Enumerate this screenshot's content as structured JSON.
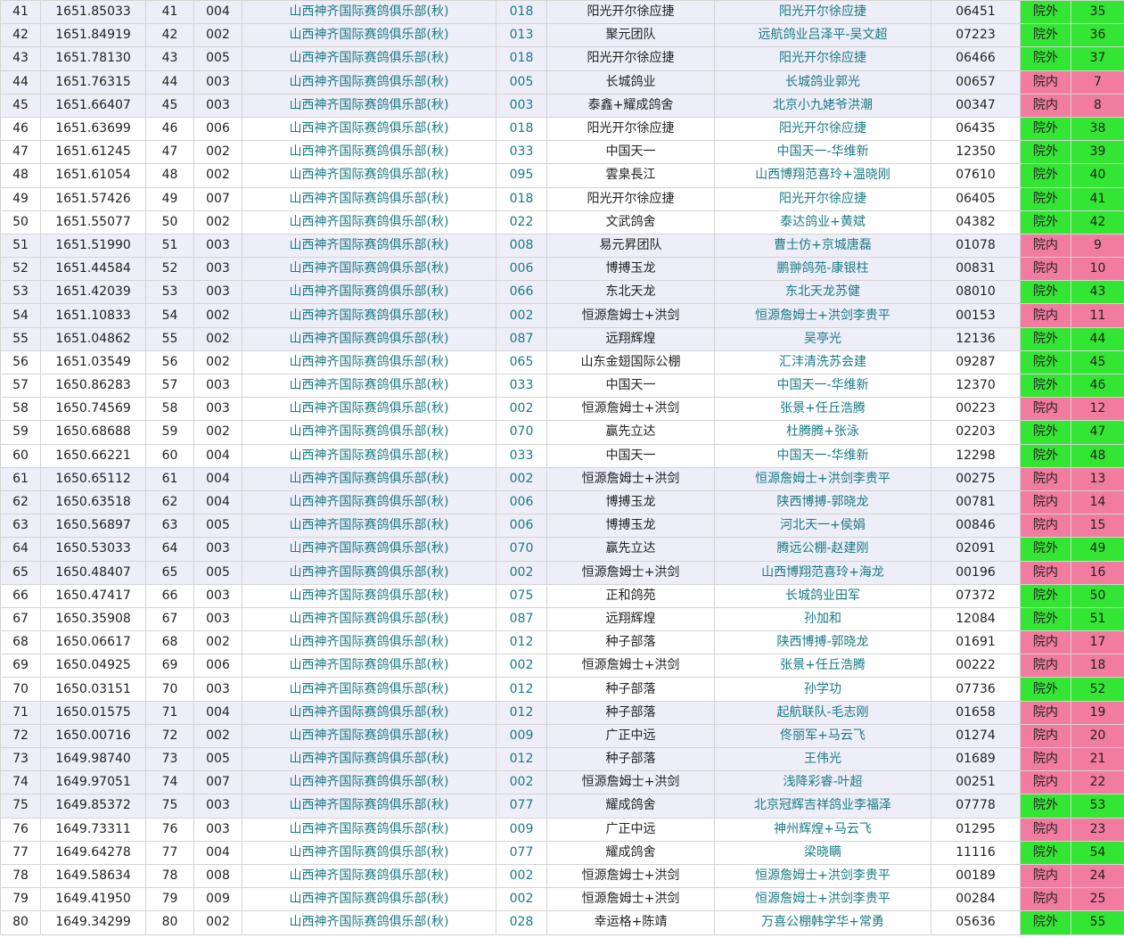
{
  "columns": [
    "rank",
    "speed",
    "order",
    "count",
    "club",
    "club_no",
    "team",
    "owner",
    "ring",
    "status",
    "group_rank"
  ],
  "colors": {
    "in": "#f27ba0",
    "out": "#33e633",
    "teal": "#1a7a84",
    "band": "#eeeef9"
  },
  "rows": [
    [
      "41",
      "1651.85033",
      "41",
      "004",
      "山西神齐国际赛鸽俱乐部(秋)",
      "018",
      "阳光开尔徐应捷",
      "阳光开尔徐应捷",
      "06451",
      "院外",
      "35"
    ],
    [
      "42",
      "1651.84919",
      "42",
      "002",
      "山西神齐国际赛鸽俱乐部(秋)",
      "013",
      "聚元团队",
      "远航鸽业吕泽平-吴文超",
      "07223",
      "院外",
      "36"
    ],
    [
      "43",
      "1651.78130",
      "43",
      "005",
      "山西神齐国际赛鸽俱乐部(秋)",
      "018",
      "阳光开尔徐应捷",
      "阳光开尔徐应捷",
      "06466",
      "院外",
      "37"
    ],
    [
      "44",
      "1651.76315",
      "44",
      "003",
      "山西神齐国际赛鸽俱乐部(秋)",
      "005",
      "长城鸽业",
      "长城鸽业郭光",
      "00657",
      "院内",
      "7"
    ],
    [
      "45",
      "1651.66407",
      "45",
      "003",
      "山西神齐国际赛鸽俱乐部(秋)",
      "003",
      "泰鑫+耀成鸽舍",
      "北京小九姥爷洪潮",
      "00347",
      "院内",
      "8"
    ],
    [
      "46",
      "1651.63699",
      "46",
      "006",
      "山西神齐国际赛鸽俱乐部(秋)",
      "018",
      "阳光开尔徐应捷",
      "阳光开尔徐应捷",
      "06435",
      "院外",
      "38"
    ],
    [
      "47",
      "1651.61245",
      "47",
      "002",
      "山西神齐国际赛鸽俱乐部(秋)",
      "033",
      "中国天一",
      "中国天一-华维新",
      "12350",
      "院外",
      "39"
    ],
    [
      "48",
      "1651.61054",
      "48",
      "002",
      "山西神齐国际赛鸽俱乐部(秋)",
      "095",
      "雲臬長江",
      "山西博翔范喜玲+温晓刚",
      "07610",
      "院外",
      "40"
    ],
    [
      "49",
      "1651.57426",
      "49",
      "007",
      "山西神齐国际赛鸽俱乐部(秋)",
      "018",
      "阳光开尔徐应捷",
      "阳光开尔徐应捷",
      "06405",
      "院外",
      "41"
    ],
    [
      "50",
      "1651.55077",
      "50",
      "002",
      "山西神齐国际赛鸽俱乐部(秋)",
      "022",
      "文武鸽舍",
      "泰达鸽业+黄斌",
      "04382",
      "院外",
      "42"
    ],
    [
      "51",
      "1651.51990",
      "51",
      "003",
      "山西神齐国际赛鸽俱乐部(秋)",
      "008",
      "易元昇团队",
      "曹士仿+京城唐磊",
      "01078",
      "院内",
      "9"
    ],
    [
      "52",
      "1651.44584",
      "52",
      "003",
      "山西神齐国际赛鸽俱乐部(秋)",
      "006",
      "博搏玉龙",
      "鹏翀鸽苑-康银柱",
      "00831",
      "院内",
      "10"
    ],
    [
      "53",
      "1651.42039",
      "53",
      "003",
      "山西神齐国际赛鸽俱乐部(秋)",
      "066",
      "东北天龙",
      "东北天龙苏健",
      "08010",
      "院外",
      "43"
    ],
    [
      "54",
      "1651.10833",
      "54",
      "002",
      "山西神齐国际赛鸽俱乐部(秋)",
      "002",
      "恒源詹姆士+洪剑",
      "恒源詹姆士+洪剑李贵平",
      "00153",
      "院内",
      "11"
    ],
    [
      "55",
      "1651.04862",
      "55",
      "002",
      "山西神齐国际赛鸽俱乐部(秋)",
      "087",
      "远翔辉煌",
      "吴亭光",
      "12136",
      "院外",
      "44"
    ],
    [
      "56",
      "1651.03549",
      "56",
      "002",
      "山西神齐国际赛鸽俱乐部(秋)",
      "065",
      "山东金翅国际公棚",
      "汇沣清洗苏会建",
      "09287",
      "院外",
      "45"
    ],
    [
      "57",
      "1650.86283",
      "57",
      "003",
      "山西神齐国际赛鸽俱乐部(秋)",
      "033",
      "中国天一",
      "中国天一-华维新",
      "12370",
      "院外",
      "46"
    ],
    [
      "58",
      "1650.74569",
      "58",
      "003",
      "山西神齐国际赛鸽俱乐部(秋)",
      "002",
      "恒源詹姆士+洪剑",
      "张景+任丘浩腾",
      "00223",
      "院内",
      "12"
    ],
    [
      "59",
      "1650.68688",
      "59",
      "002",
      "山西神齐国际赛鸽俱乐部(秋)",
      "070",
      "赢先立达",
      "杜腾腾+张泳",
      "02203",
      "院外",
      "47"
    ],
    [
      "60",
      "1650.66221",
      "60",
      "004",
      "山西神齐国际赛鸽俱乐部(秋)",
      "033",
      "中国天一",
      "中国天一-华维新",
      "12298",
      "院外",
      "48"
    ],
    [
      "61",
      "1650.65112",
      "61",
      "004",
      "山西神齐国际赛鸽俱乐部(秋)",
      "002",
      "恒源詹姆士+洪剑",
      "恒源詹姆士+洪剑李贵平",
      "00275",
      "院内",
      "13"
    ],
    [
      "62",
      "1650.63518",
      "62",
      "004",
      "山西神齐国际赛鸽俱乐部(秋)",
      "006",
      "博搏玉龙",
      "陕西博搏-郭晓龙",
      "00781",
      "院内",
      "14"
    ],
    [
      "63",
      "1650.56897",
      "63",
      "005",
      "山西神齐国际赛鸽俱乐部(秋)",
      "006",
      "博搏玉龙",
      "河北天一+侯娟",
      "00846",
      "院内",
      "15"
    ],
    [
      "64",
      "1650.53033",
      "64",
      "003",
      "山西神齐国际赛鸽俱乐部(秋)",
      "070",
      "赢先立达",
      "腾远公棚-赵建刚",
      "02091",
      "院外",
      "49"
    ],
    [
      "65",
      "1650.48407",
      "65",
      "005",
      "山西神齐国际赛鸽俱乐部(秋)",
      "002",
      "恒源詹姆士+洪剑",
      "山西博翔范喜玲+海龙",
      "00196",
      "院内",
      "16"
    ],
    [
      "66",
      "1650.47417",
      "66",
      "003",
      "山西神齐国际赛鸽俱乐部(秋)",
      "075",
      "正和鸽苑",
      "长城鸽业田军",
      "07372",
      "院外",
      "50"
    ],
    [
      "67",
      "1650.35908",
      "67",
      "003",
      "山西神齐国际赛鸽俱乐部(秋)",
      "087",
      "远翔辉煌",
      "孙加和",
      "12084",
      "院外",
      "51"
    ],
    [
      "68",
      "1650.06617",
      "68",
      "002",
      "山西神齐国际赛鸽俱乐部(秋)",
      "012",
      "种子部落",
      "陕西博搏-郭晓龙",
      "01691",
      "院内",
      "17"
    ],
    [
      "69",
      "1650.04925",
      "69",
      "006",
      "山西神齐国际赛鸽俱乐部(秋)",
      "002",
      "恒源詹姆士+洪剑",
      "张景+任丘浩腾",
      "00222",
      "院内",
      "18"
    ],
    [
      "70",
      "1650.03151",
      "70",
      "003",
      "山西神齐国际赛鸽俱乐部(秋)",
      "012",
      "种子部落",
      "孙学功",
      "07736",
      "院外",
      "52"
    ],
    [
      "71",
      "1650.01575",
      "71",
      "004",
      "山西神齐国际赛鸽俱乐部(秋)",
      "012",
      "种子部落",
      "起航联队-毛志刚",
      "01658",
      "院内",
      "19"
    ],
    [
      "72",
      "1650.00716",
      "72",
      "002",
      "山西神齐国际赛鸽俱乐部(秋)",
      "009",
      "广正中远",
      "佟丽军+马云飞",
      "01274",
      "院内",
      "20"
    ],
    [
      "73",
      "1649.98740",
      "73",
      "005",
      "山西神齐国际赛鸽俱乐部(秋)",
      "012",
      "种子部落",
      "王伟光",
      "01689",
      "院内",
      "21"
    ],
    [
      "74",
      "1649.97051",
      "74",
      "007",
      "山西神齐国际赛鸽俱乐部(秋)",
      "002",
      "恒源詹姆士+洪剑",
      "浅降彩睿-叶超",
      "00251",
      "院内",
      "22"
    ],
    [
      "75",
      "1649.85372",
      "75",
      "003",
      "山西神齐国际赛鸽俱乐部(秋)",
      "077",
      "耀成鸽舍",
      "北京冠辉吉祥鸽业李福泽",
      "07778",
      "院外",
      "53"
    ],
    [
      "76",
      "1649.73311",
      "76",
      "003",
      "山西神齐国际赛鸽俱乐部(秋)",
      "009",
      "广正中远",
      "神州辉煌+马云飞",
      "01295",
      "院内",
      "23"
    ],
    [
      "77",
      "1649.64278",
      "77",
      "004",
      "山西神齐国际赛鸽俱乐部(秋)",
      "077",
      "耀成鸽舍",
      "梁晓瞒",
      "11116",
      "院外",
      "54"
    ],
    [
      "78",
      "1649.58634",
      "78",
      "008",
      "山西神齐国际赛鸽俱乐部(秋)",
      "002",
      "恒源詹姆士+洪剑",
      "恒源詹姆士+洪剑李贵平",
      "00189",
      "院内",
      "24"
    ],
    [
      "79",
      "1649.41950",
      "79",
      "009",
      "山西神齐国际赛鸽俱乐部(秋)",
      "002",
      "恒源詹姆士+洪剑",
      "恒源詹姆士+洪剑李贵平",
      "00284",
      "院内",
      "25"
    ],
    [
      "80",
      "1649.34299",
      "80",
      "002",
      "山西神齐国际赛鸽俱乐部(秋)",
      "028",
      "幸运格+陈靖",
      "万喜公棚韩学华+常勇",
      "05636",
      "院外",
      "55"
    ]
  ]
}
